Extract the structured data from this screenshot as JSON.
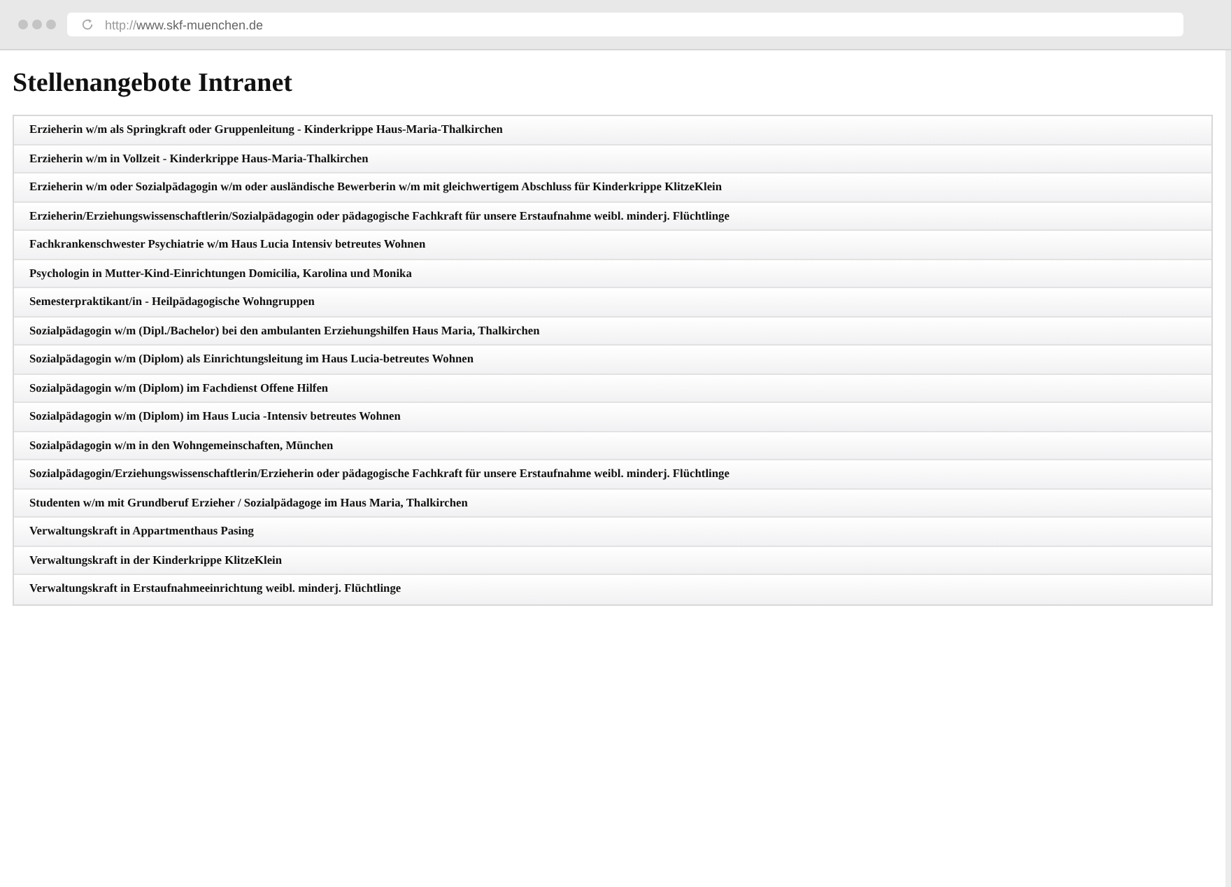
{
  "browser": {
    "url_scheme": "http://",
    "url_host": "www.skf-muenchen.de"
  },
  "page": {
    "title": "Stellenangebote Intranet",
    "jobs": [
      "Erzieherin w/m als Springkraft oder Gruppenleitung - Kinderkrippe Haus-Maria-Thalkirchen",
      "Erzieherin w/m in Vollzeit - Kinderkrippe Haus-Maria-Thalkirchen",
      "Erzieherin w/m oder Sozialpädagogin w/m oder ausländische Bewerberin w/m mit gleichwertigem Abschluss für Kinderkrippe KlitzeKlein",
      "Erzieherin/Erziehungswissenschaftlerin/Sozialpädagogin oder pädagogische Fachkraft für unsere Erstaufnahme weibl. minderj. Flüchtlinge",
      "Fachkrankenschwester Psychiatrie w/m Haus Lucia Intensiv betreutes Wohnen",
      "Psychologin in Mutter-Kind-Einrichtungen Domicilia, Karolina und Monika",
      "Semesterpraktikant/in - Heilpädagogische Wohngruppen",
      "Sozialpädagogin w/m (Dipl./Bachelor) bei den ambulanten Erziehungshilfen Haus Maria, Thalkirchen",
      "Sozialpädagogin w/m (Diplom) als Einrichtungsleitung im Haus Lucia-betreutes Wohnen",
      "Sozialpädagogin w/m (Diplom) im Fachdienst Offene Hilfen",
      "Sozialpädagogin w/m (Diplom) im Haus Lucia -Intensiv betreutes Wohnen",
      "Sozialpädagogin w/m in den Wohngemeinschaften, München",
      "Sozialpädagogin/Erziehungswissenschaftlerin/Erzieherin oder pädagogische Fachkraft für unsere Erstaufnahme weibl. minderj. Flüchtlinge",
      "Studenten w/m mit Grundberuf Erzieher / Sozialpädagoge im Haus Maria, Thalkirchen",
      "Verwaltungskraft in Appartmenthaus Pasing",
      "Verwaltungskraft in der Kinderkrippe KlitzeKlein",
      "Verwaltungskraft in Erstaufnahmeeinrichtung weibl. minderj. Flüchtlinge"
    ]
  }
}
